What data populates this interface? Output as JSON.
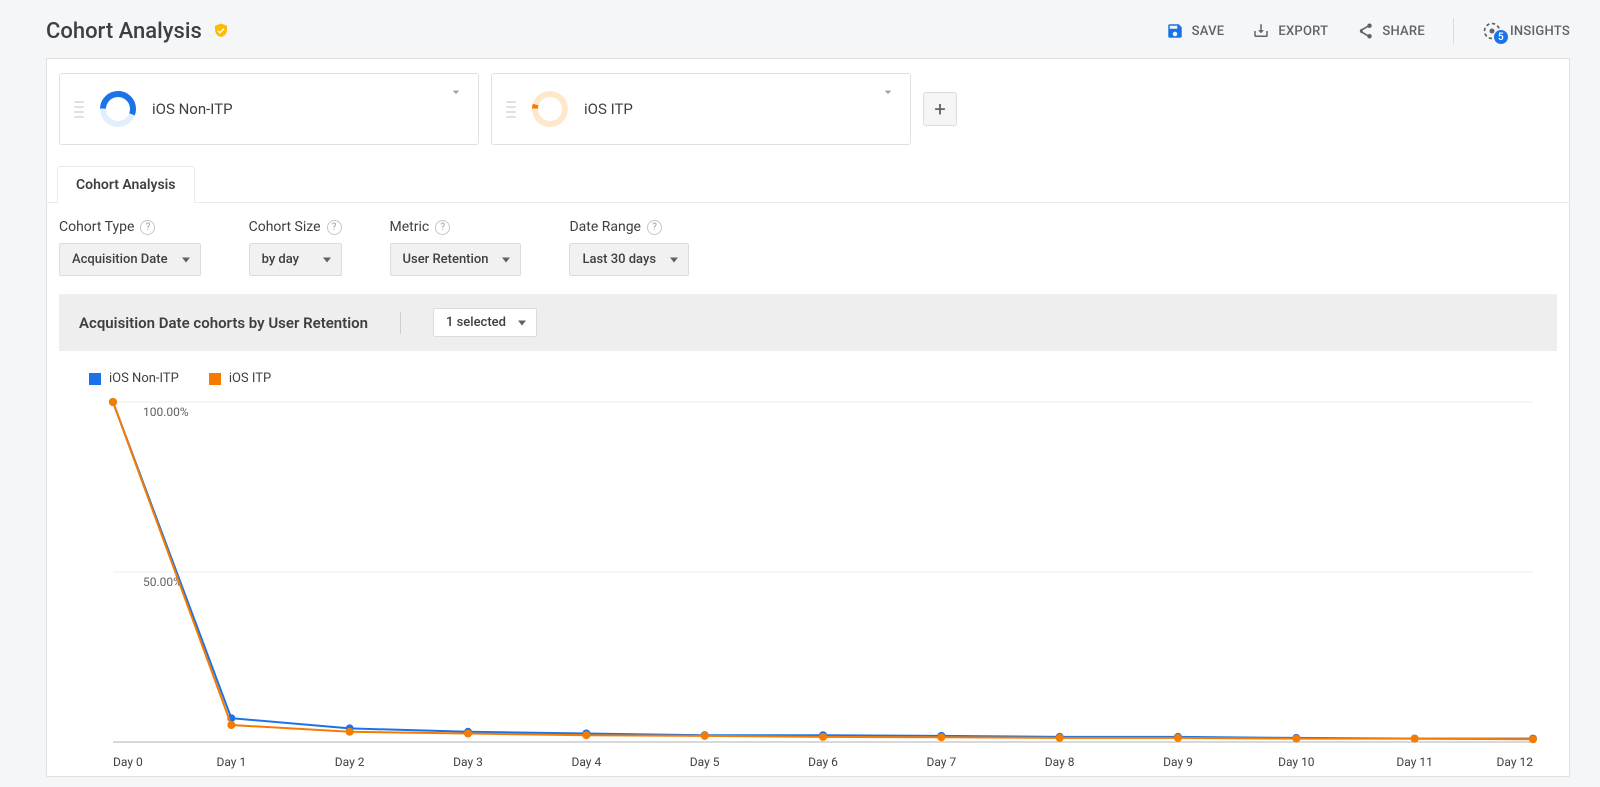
{
  "header": {
    "title": "Cohort Analysis",
    "actions": {
      "save": "SAVE",
      "export": "EXPORT",
      "share": "SHARE",
      "insights": "INSIGHTS",
      "insights_count": "5"
    }
  },
  "segments": [
    {
      "name": "iOS Non-ITP",
      "color": "#1a73e8",
      "arc_fraction": 0.55
    },
    {
      "name": "iOS ITP",
      "color": "#f57c00",
      "arc_fraction": 0.04
    }
  ],
  "tab": {
    "label": "Cohort Analysis"
  },
  "controls": {
    "cohort_type": {
      "label": "Cohort Type",
      "value": "Acquisition Date"
    },
    "cohort_size": {
      "label": "Cohort Size",
      "value": "by day"
    },
    "metric": {
      "label": "Metric",
      "value": "User Retention"
    },
    "date_range": {
      "label": "Date Range",
      "value": "Last 30 days"
    }
  },
  "chart_header": {
    "title": "Acquisition Date cohorts by User Retention",
    "selected": "1 selected"
  },
  "chart_data": {
    "type": "line",
    "categories": [
      "Day 0",
      "Day 1",
      "Day 2",
      "Day 3",
      "Day 4",
      "Day 5",
      "Day 6",
      "Day 7",
      "Day 8",
      "Day 9",
      "Day 10",
      "Day 11",
      "Day 12"
    ],
    "series": [
      {
        "name": "iOS Non-ITP",
        "color": "#1a73e8",
        "values": [
          100,
          7,
          4,
          3,
          2.5,
          2,
          2,
          1.8,
          1.5,
          1.5,
          1.2,
          1,
          1
        ]
      },
      {
        "name": "iOS ITP",
        "color": "#f57c00",
        "values": [
          100,
          5,
          3,
          2.5,
          2,
          1.8,
          1.5,
          1.4,
          1.2,
          1.2,
          1,
          1,
          0.8
        ]
      }
    ],
    "ylabel": "",
    "xlabel": "",
    "ylim": [
      0,
      100
    ],
    "yticks": [
      50,
      100
    ],
    "ytick_labels": [
      "50.00%",
      "100.00%"
    ]
  }
}
